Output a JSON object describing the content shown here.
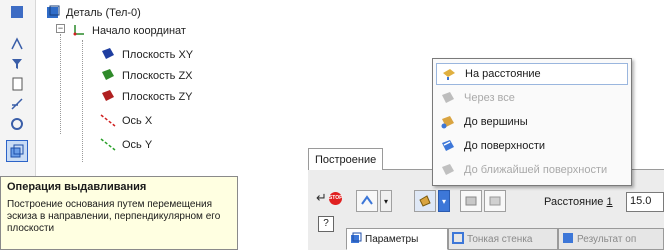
{
  "tree": {
    "root": "Деталь (Тел-0)",
    "origin": "Начало координат",
    "items": [
      {
        "label": "Плоскость XY",
        "color": "#1f3ea0"
      },
      {
        "label": "Плоскость ZX",
        "color": "#2f8a2a"
      },
      {
        "label": "Плоскость ZY",
        "color": "#b02020"
      },
      {
        "label": "Ось X",
        "color": "#d02020"
      },
      {
        "label": "Ось Y",
        "color": "#28a028"
      }
    ]
  },
  "tooltip": {
    "title": "Операция выдавливания",
    "body": "Построение основания путем перемещения эскиза в направлении, перпендикулярном его плоскости"
  },
  "panel": {
    "tab_label": "Построение",
    "distance_label_pre": "Расстояние ",
    "distance_label_num": "1",
    "distance_value": "15.0",
    "bottom_tabs": [
      "Параметры",
      "Тонкая стенка",
      "Результат оп"
    ]
  },
  "menu": {
    "items": [
      {
        "label": "На расстояние",
        "enabled": true
      },
      {
        "label": "Через все",
        "enabled": false
      },
      {
        "label": "До вершины",
        "enabled": true
      },
      {
        "label": "До поверхности",
        "enabled": true
      },
      {
        "label": "До ближайшей поверхности",
        "enabled": false
      }
    ]
  },
  "colors": {
    "accent": "#3d77d8",
    "tooltip_bg": "#ffffe1",
    "stop": "#e02020"
  }
}
